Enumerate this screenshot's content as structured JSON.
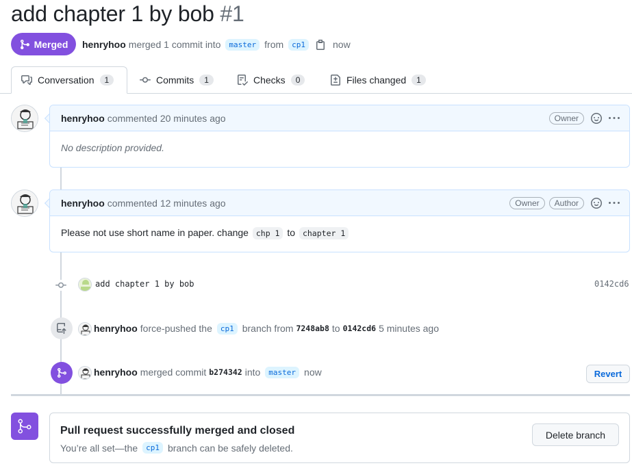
{
  "pr": {
    "title": "add chapter 1 by bob",
    "number": "#1",
    "state": "Merged",
    "author": "henryhoo",
    "merged_text": "merged 1 commit into",
    "base_branch": "master",
    "from_text": "from",
    "head_branch": "cp1",
    "time": "now"
  },
  "tabs": [
    {
      "label": "Conversation",
      "count": "1",
      "icon": "comment-discussion-icon"
    },
    {
      "label": "Commits",
      "count": "1",
      "icon": "git-commit-icon"
    },
    {
      "label": "Checks",
      "count": "0",
      "icon": "checklist-icon"
    },
    {
      "label": "Files changed",
      "count": "1",
      "icon": "file-diff-icon"
    }
  ],
  "comments": [
    {
      "author": "henryhoo",
      "action": "commented 20 minutes ago",
      "labels": [
        "Owner"
      ],
      "body": "No description provided."
    },
    {
      "author": "henryhoo",
      "action": "commented 12 minutes ago",
      "labels": [
        "Owner",
        "Author"
      ],
      "body_prefix": "Please not use short name in paper. change",
      "code1": "chp 1",
      "body_mid": "to",
      "code2": "chapter 1"
    }
  ],
  "commit_event": {
    "message": "add chapter 1 by bob",
    "sha": "0142cd6"
  },
  "push_event": {
    "author": "henryhoo",
    "action": "force-pushed the",
    "branch": "cp1",
    "from_text": "branch from",
    "old_sha": "7248ab8",
    "to_text": "to",
    "new_sha": "0142cd6",
    "time": "5 minutes ago"
  },
  "merge_event": {
    "author": "henryhoo",
    "action": "merged commit",
    "sha": "b274342",
    "into_text": "into",
    "branch": "master",
    "time": "now",
    "revert_label": "Revert"
  },
  "merge_box": {
    "title": "Pull request successfully merged and closed",
    "desc_prefix": "You’re all set—the",
    "branch": "cp1",
    "desc_suffix": "branch can be safely deleted.",
    "delete_label": "Delete branch"
  },
  "colors": {
    "merged": "#8250df",
    "link": "#0969da",
    "border": "#d0d7de"
  }
}
